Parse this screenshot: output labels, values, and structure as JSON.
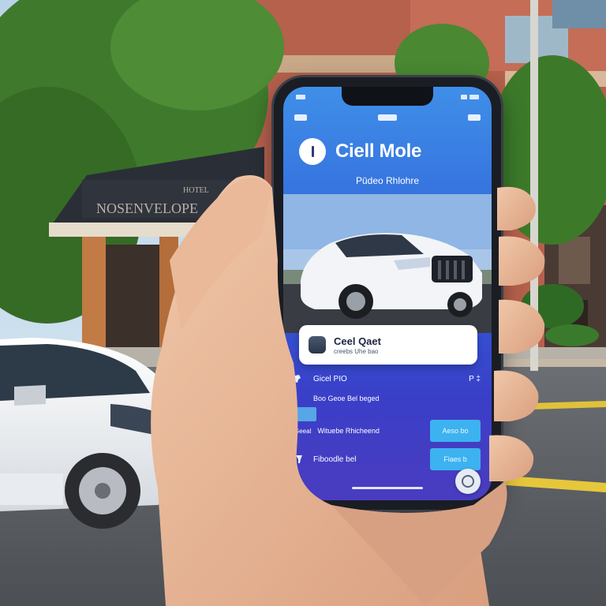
{
  "scene": {
    "sign_text": "HOTEL",
    "sign_subtext": "NOSENVELOPE"
  },
  "app": {
    "title": "Ciell Mole",
    "subtitle": "Pūdeo Rhlohre",
    "card": {
      "name": "Ceel Qaet",
      "sub": "creebs Uhe bao"
    },
    "rows": [
      {
        "label": "Gicel PIO",
        "value": "P ‡"
      },
      {
        "label": "Boo Geoe Bel beged"
      },
      {
        "label": "Wituebe Rhicheend",
        "prefix": "Geeal",
        "button": "Aeso bo"
      },
      {
        "label": "Fiboodle bel",
        "button": "Fiaes b"
      }
    ]
  },
  "colors": {
    "screen_top": "#3f8fe8",
    "screen_bottom": "#4a3cc0",
    "button": "#3db2f0",
    "car_white": "#f2f4f7"
  }
}
